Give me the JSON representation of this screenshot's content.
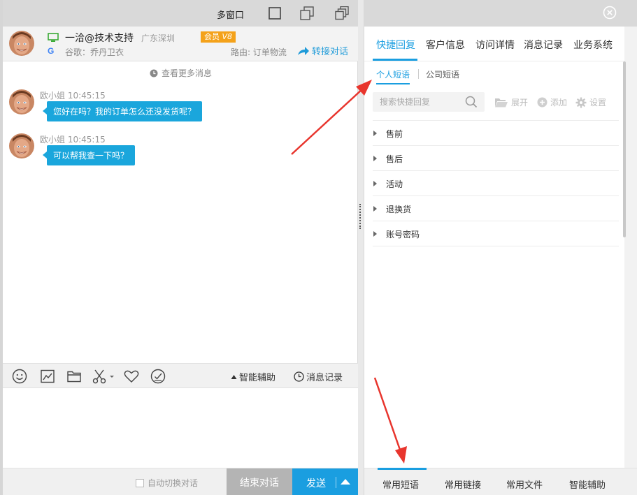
{
  "titlebar": {
    "title": "多窗口"
  },
  "customer": {
    "name": "一洽@技术支持",
    "location": "广东深圳",
    "vip_label": "会员",
    "vip_level": "V8",
    "google_mark": "G",
    "sub": "谷歌：乔丹卫衣",
    "route": "路由: 订单物流",
    "transfer": "转接对话"
  },
  "chat": {
    "more_messages": "查看更多消息",
    "messages": [
      {
        "sender": "欧小姐",
        "time": "10:45:15",
        "text": "您好在吗？我的订单怎么还没发货呢？"
      },
      {
        "sender": "欧小姐",
        "time": "10:45:15",
        "text": "可以帮我查一下吗？"
      }
    ]
  },
  "toolbar": {
    "smart_assist": "智能辅助",
    "message_history": "消息记录"
  },
  "footer": {
    "auto_switch": "自动切换对话",
    "end": "结束对话",
    "send": "发送"
  },
  "right": {
    "tabs": [
      "快捷回复",
      "客户信息",
      "访问详情",
      "消息记录",
      "业务系统"
    ],
    "subtabs": {
      "personal": "个人短语",
      "company": "公司短语"
    },
    "search_placeholder": "搜索快捷回复",
    "actions": {
      "expand": "展开",
      "add": "添加",
      "settings": "设置"
    },
    "categories": [
      "售前",
      "售后",
      "活动",
      "退换货",
      "账号密码"
    ],
    "bottom_tabs": [
      "常用短语",
      "常用链接",
      "常用文件",
      "智能辅助"
    ]
  },
  "colors": {
    "accent": "#1a9ee0",
    "bubble": "#1aa6dc",
    "vip": "#f4a21a",
    "arrow": "#e8352d"
  }
}
